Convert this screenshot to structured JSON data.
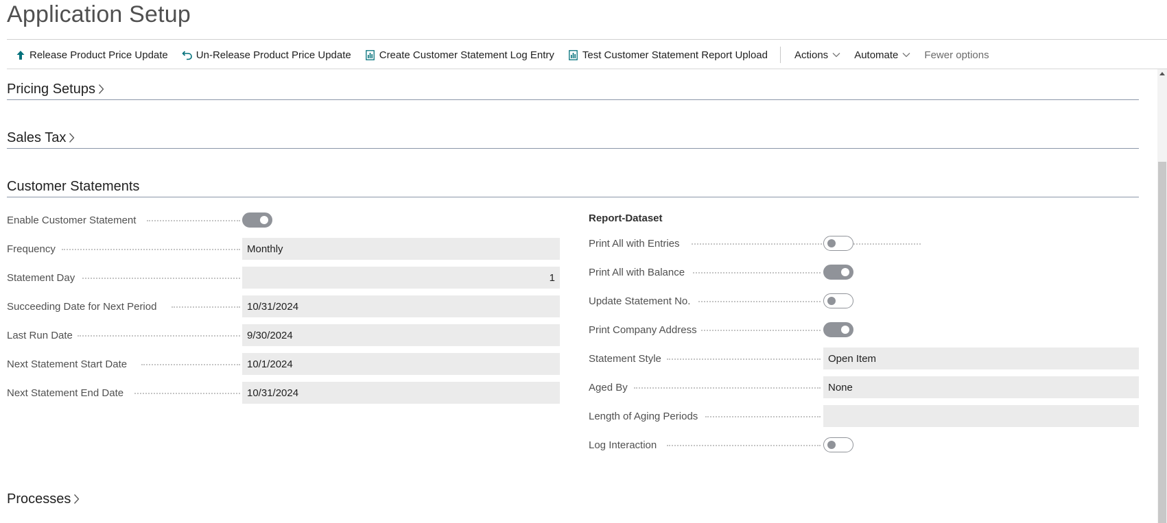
{
  "page": {
    "title": "Application Setup"
  },
  "toolbar": {
    "actions": [
      {
        "label": "Release Product Price Update",
        "icon": "arrow-up-icon"
      },
      {
        "label": "Un-Release Product Price Update",
        "icon": "undo-arrow-icon"
      },
      {
        "label": "Create Customer Statement Log Entry",
        "icon": "report-icon"
      },
      {
        "label": "Test Customer Statement Report Upload",
        "icon": "report-icon"
      }
    ],
    "menus": [
      {
        "label": "Actions",
        "icon": "chevron-down-icon"
      },
      {
        "label": "Automate",
        "icon": "chevron-down-icon"
      }
    ],
    "fewer_options": "Fewer options"
  },
  "sections": {
    "pricing": {
      "title": "Pricing Setups",
      "expanded": false
    },
    "sales_tax": {
      "title": "Sales Tax",
      "expanded": false
    },
    "customer_statements": {
      "title": "Customer Statements",
      "expanded": true
    },
    "processes": {
      "title": "Processes",
      "expanded": false
    }
  },
  "customer_statements": {
    "left_fields": [
      {
        "label": "Enable Customer Statement",
        "type": "toggle",
        "value": true
      },
      {
        "label": "Frequency",
        "type": "text",
        "value": "Monthly"
      },
      {
        "label": "Statement Day",
        "type": "number",
        "value": "1"
      },
      {
        "label": "Succeeding Date for Next Period",
        "type": "text",
        "value": "10/31/2024"
      },
      {
        "label": "Last Run Date",
        "type": "text",
        "value": "9/30/2024"
      },
      {
        "label": "Next Statement Start Date",
        "type": "text",
        "value": "10/1/2024"
      },
      {
        "label": "Next Statement End Date",
        "type": "text",
        "value": "10/31/2024"
      }
    ],
    "report_dataset": {
      "title": "Report-Dataset",
      "fields": [
        {
          "label": "Print All with Entries",
          "type": "toggle",
          "value": false
        },
        {
          "label": "Print All with Balance",
          "type": "toggle",
          "value": true
        },
        {
          "label": "Update Statement No.",
          "type": "toggle",
          "value": false
        },
        {
          "label": "Print Company Address",
          "type": "toggle",
          "value": true
        },
        {
          "label": "Statement Style",
          "type": "text",
          "value": "Open Item"
        },
        {
          "label": "Aged By",
          "type": "text",
          "value": "None"
        },
        {
          "label": "Length of Aging Periods",
          "type": "text",
          "value": ""
        },
        {
          "label": "Log Interaction",
          "type": "toggle",
          "value": false
        }
      ]
    }
  },
  "colors": {
    "accent": "#00707a",
    "toggle_on": "#909399",
    "field_bg": "#ebebeb",
    "section_rule": "#8a96a8"
  }
}
